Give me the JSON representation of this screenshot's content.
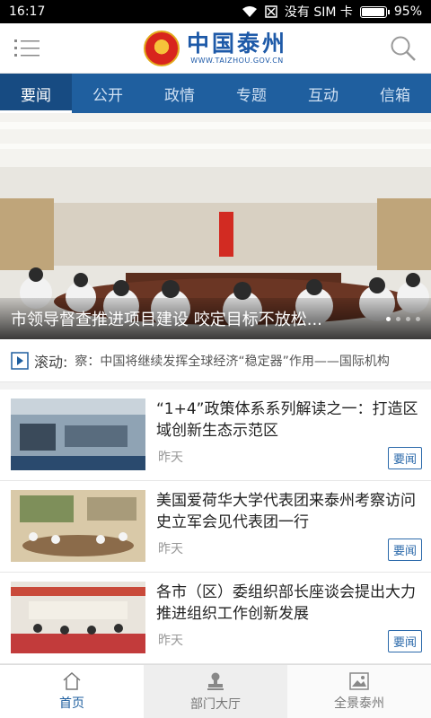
{
  "status": {
    "time": "16:17",
    "carrier": "没有 SIM 卡",
    "battery": "95%",
    "battery_level": 0.95
  },
  "header": {
    "title_cn": "中国泰州",
    "title_en": "WWW.TAIZHOU.GOV.CN",
    "menu_icon": "menu-icon",
    "search_icon": "search-icon"
  },
  "tabs": [
    {
      "label": "要闻",
      "active": true
    },
    {
      "label": "公开"
    },
    {
      "label": "政情"
    },
    {
      "label": "专题"
    },
    {
      "label": "互动"
    },
    {
      "label": "信箱"
    }
  ],
  "hero": {
    "caption": "市领导督查推进项目建设 咬定目标不放松..."
  },
  "ticker": {
    "label": "滚动:",
    "text": "察：中国将继续发挥全球经济“稳定器”作用——国际机构"
  },
  "news": [
    {
      "title": "“1+4”政策体系系列解读之一：打造区域创新生态示范区",
      "time": "昨天",
      "tag": "要闻"
    },
    {
      "title": "美国爱荷华大学代表团来泰州考察访问 史立军会见代表团一行",
      "time": "昨天",
      "tag": "要闻"
    },
    {
      "title": "各市（区）委组织部长座谈会提出大力推进组织工作创新发展",
      "time": "昨天",
      "tag": "要闻"
    }
  ],
  "bottom_nav": [
    {
      "label": "首页",
      "icon": "home-icon",
      "active": true
    },
    {
      "label": "部门大厅",
      "icon": "stamp-icon"
    },
    {
      "label": "全景泰州",
      "icon": "image-icon"
    }
  ]
}
